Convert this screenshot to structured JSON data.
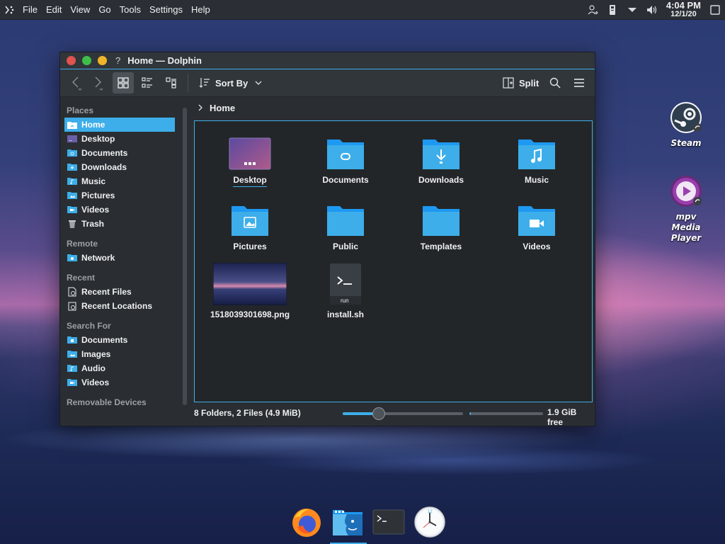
{
  "menubar": {
    "items": [
      "File",
      "Edit",
      "View",
      "Go",
      "Tools",
      "Settings",
      "Help"
    ],
    "clock_time": "4:04 PM",
    "clock_date": "12/1/20"
  },
  "window": {
    "title": "Home — Dolphin",
    "help": "?",
    "toolbar": {
      "sort_label": "Sort By",
      "split_label": "Split"
    },
    "sidebar": {
      "places_header": "Places",
      "places": [
        "Home",
        "Desktop",
        "Documents",
        "Downloads",
        "Music",
        "Pictures",
        "Videos",
        "Trash"
      ],
      "remote_header": "Remote",
      "remote": [
        "Network"
      ],
      "recent_header": "Recent",
      "recent": [
        "Recent Files",
        "Recent Locations"
      ],
      "search_header": "Search For",
      "search": [
        "Documents",
        "Images",
        "Audio",
        "Videos"
      ],
      "removable_header": "Removable Devices"
    },
    "breadcrumb": "Home",
    "files": [
      {
        "name": "Desktop",
        "kind": "desktop-folder"
      },
      {
        "name": "Documents",
        "kind": "documents-folder"
      },
      {
        "name": "Downloads",
        "kind": "downloads-folder"
      },
      {
        "name": "Music",
        "kind": "music-folder"
      },
      {
        "name": "Pictures",
        "kind": "pictures-folder"
      },
      {
        "name": "Public",
        "kind": "folder"
      },
      {
        "name": "Templates",
        "kind": "folder"
      },
      {
        "name": "Videos",
        "kind": "videos-folder"
      },
      {
        "name": "1518039301698.png",
        "kind": "image-thumbnail"
      },
      {
        "name": "install.sh",
        "kind": "script",
        "badge": "run"
      }
    ],
    "status": {
      "summary": "8 Folders, 2 Files (4.9 MiB)",
      "zoom_level": 0.3,
      "disk_used_fraction": 0.02,
      "free_space": "1.9 GiB free"
    }
  },
  "desktop_icons": [
    {
      "label": "Steam",
      "icon": "steam-icon"
    },
    {
      "label": "mpv Media Player",
      "icon": "mpv-icon"
    }
  ],
  "dock": [
    "firefox-icon",
    "dolphin-icon",
    "terminal-icon",
    "clock-icon"
  ],
  "colors": {
    "accent": "#3daee9",
    "window_bg": "#2a2e32",
    "view_bg": "#232629"
  }
}
